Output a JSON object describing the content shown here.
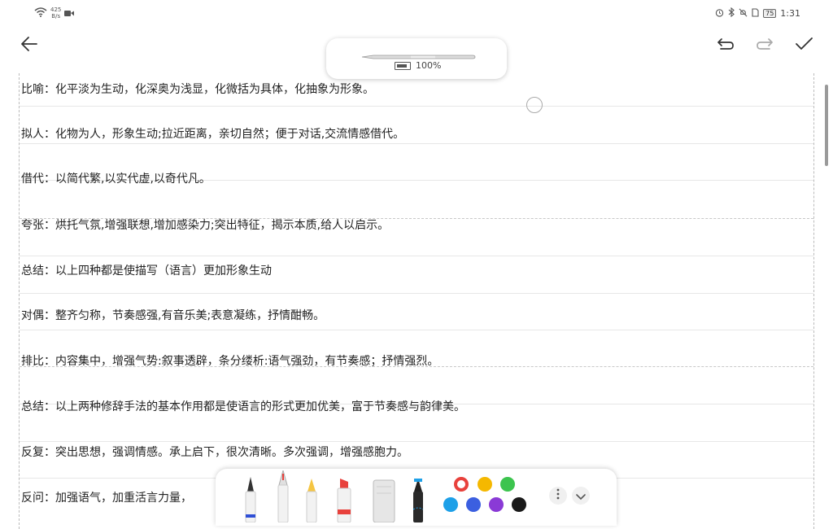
{
  "status": {
    "speed_value": "425",
    "speed_unit": "B/s",
    "battery": "75",
    "time": "1:31"
  },
  "pen_popup": {
    "battery_text": "100%"
  },
  "notes": [
    "比喻：化平淡为生动，化深奥为浅显，化微括为具体，化抽象为形象。",
    "拟人：化物为人，形象生动;拉近距离，亲切自然；便于对话,交流情感借代。",
    "借代：以简代繁,以实代虚,以奇代凡。",
    "夸张：烘托气氛,增强联想,增加感染力;突出特征，揭示本质,给人以启示。",
    "总结：以上四种都是使描写（语言）更加形象生动",
    "对偶：整齐匀称，节奏感强,有音乐美;表意凝练，抒情酣畅。",
    "排比：内容集中，增强气势:叙事透辟，条分缕析:语气强劲，有节奏感；抒情强烈。",
    "总结：以上两种修辞手法的基本作用都是使语言的形式更加优美，富于节奏感与韵律美。",
    "反复：突出思想，强调情感。承上启下，很次清晰。多次强调，增强感胞力。",
    "反问：加强语气，加重活言力量，"
  ],
  "colors": {
    "swatches": [
      "#e8413c",
      "#f5b800",
      "#3cc44e",
      "#1ea0e8",
      "#3b5fe0",
      "#8a3ad6",
      "#1a1a1a"
    ],
    "selected": "#e8413c"
  },
  "icons": {
    "back": "arrow-left-icon",
    "undo": "undo-icon",
    "redo": "redo-icon",
    "done": "check-icon",
    "more": "more-vertical-icon",
    "collapse": "chevron-down-icon"
  }
}
